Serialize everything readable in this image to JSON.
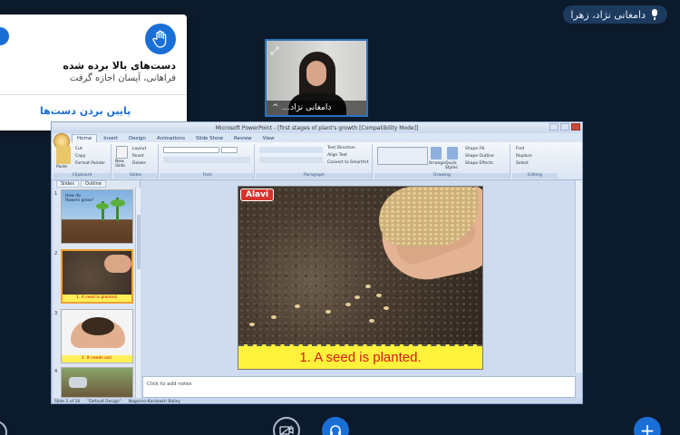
{
  "presenter_pill": {
    "name": "دامغانی نژاد، زهرا",
    "icon": "mic-icon"
  },
  "hand_notification": {
    "title": "دست‌های بالا برده شده",
    "subtitle": "فراهانی، آیسان اجازه گرفت",
    "action_label": "پایین بردن دست‌ها",
    "icon": "raised-hand-icon"
  },
  "webcam": {
    "name": "دامغانی نژاد...",
    "menu_glyph": "^"
  },
  "powerpoint": {
    "window_title": "Microsoft PowerPoint - [first stages of plant's growth [Compatibility Mode]]",
    "tabs": [
      "Home",
      "Insert",
      "Design",
      "Animations",
      "Slide Show",
      "Review",
      "View"
    ],
    "active_tab": "Home",
    "ribbon_groups": [
      "Clipboard",
      "Slides",
      "Font",
      "Paragraph",
      "Drawing",
      "Editing"
    ],
    "ribbon_items": {
      "paste": "Paste",
      "cut": "Cut",
      "copy": "Copy",
      "format_painter": "Format Painter",
      "new_slide": "New Slide",
      "layout": "Layout",
      "reset": "Reset",
      "delete": "Delete",
      "text_direction": "Text Direction",
      "align_text": "Align Text",
      "convert_smartart": "Convert to SmartArt",
      "arrange": "Arrange",
      "quick_styles": "Quick Styles",
      "shape_fill": "Shape Fill",
      "shape_outline": "Shape Outline",
      "shape_effects": "Shape Effects",
      "find": "Find",
      "replace": "Replace",
      "select": "Select"
    },
    "pane_tabs": [
      "Slides",
      "Outline"
    ],
    "thumbnails": [
      {
        "num": "1",
        "caption": "How do flowers grow?"
      },
      {
        "num": "2",
        "caption": "1. A seed is planted."
      },
      {
        "num": "3",
        "caption": "2. It needs soil."
      },
      {
        "num": "4",
        "caption": ""
      }
    ],
    "slide": {
      "logo_text": "Alavi",
      "caption_prefix": "1. A seed is ",
      "caption_highlight": "planted",
      "caption_suffix": "."
    },
    "notes_placeholder": "Click to add notes",
    "status": {
      "slide": "Slide 2 of 16",
      "theme": "\"Default Design\"",
      "language": "Nagorno-Karabakh Bailey"
    }
  },
  "toolbar": {
    "plus_label": "+"
  },
  "colors": {
    "accent": "#1a6fd6",
    "background": "#0c1b2c",
    "caption_red": "#d31c1c",
    "caption_bar": "#fff23a"
  }
}
